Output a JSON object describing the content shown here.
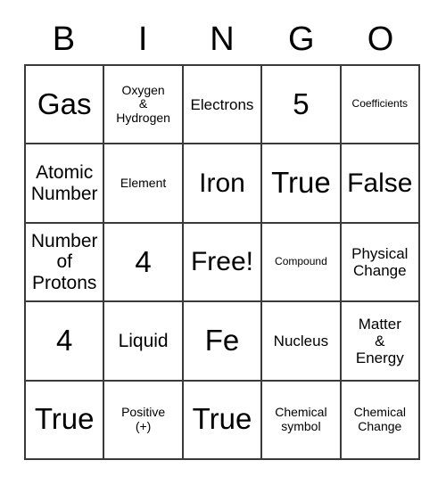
{
  "card": {
    "type": "bingo-card",
    "header_letters": [
      "B",
      "I",
      "N",
      "G",
      "O"
    ],
    "grid_size": "5x5",
    "colors": {
      "background": "#ffffff",
      "border": "#3a3a3a",
      "text": "#000000"
    },
    "free_space": {
      "row": 3,
      "column": 3,
      "label": "Free!"
    },
    "rows": [
      [
        {
          "text": "Gas",
          "size": "xl"
        },
        {
          "text": "Oxygen\n&\nHydrogen",
          "size": "xs"
        },
        {
          "text": "Electrons",
          "size": "sm"
        },
        {
          "text": "5",
          "size": "xl"
        },
        {
          "text": "Coefficients",
          "size": "xxs"
        }
      ],
      [
        {
          "text": "Atomic\nNumber",
          "size": "md"
        },
        {
          "text": "Element",
          "size": "xs"
        },
        {
          "text": "Iron",
          "size": "lg"
        },
        {
          "text": "True",
          "size": "xl"
        },
        {
          "text": "False",
          "size": "lg"
        }
      ],
      [
        {
          "text": "Number\nof\nProtons",
          "size": "md"
        },
        {
          "text": "4",
          "size": "xl"
        },
        {
          "text": "Free!",
          "size": "lg"
        },
        {
          "text": "Compound",
          "size": "xxs"
        },
        {
          "text": "Physical\nChange",
          "size": "sm"
        }
      ],
      [
        {
          "text": "4",
          "size": "xl"
        },
        {
          "text": "Liquid",
          "size": "md"
        },
        {
          "text": "Fe",
          "size": "xl"
        },
        {
          "text": "Nucleus",
          "size": "sm"
        },
        {
          "text": "Matter\n&\nEnergy",
          "size": "sm"
        }
      ],
      [
        {
          "text": "True",
          "size": "xl"
        },
        {
          "text": "Positive\n(+)",
          "size": "xs"
        },
        {
          "text": "True",
          "size": "xl"
        },
        {
          "text": "Chemical\nsymbol",
          "size": "xs"
        },
        {
          "text": "Chemical\nChange",
          "size": "xs"
        }
      ]
    ]
  }
}
